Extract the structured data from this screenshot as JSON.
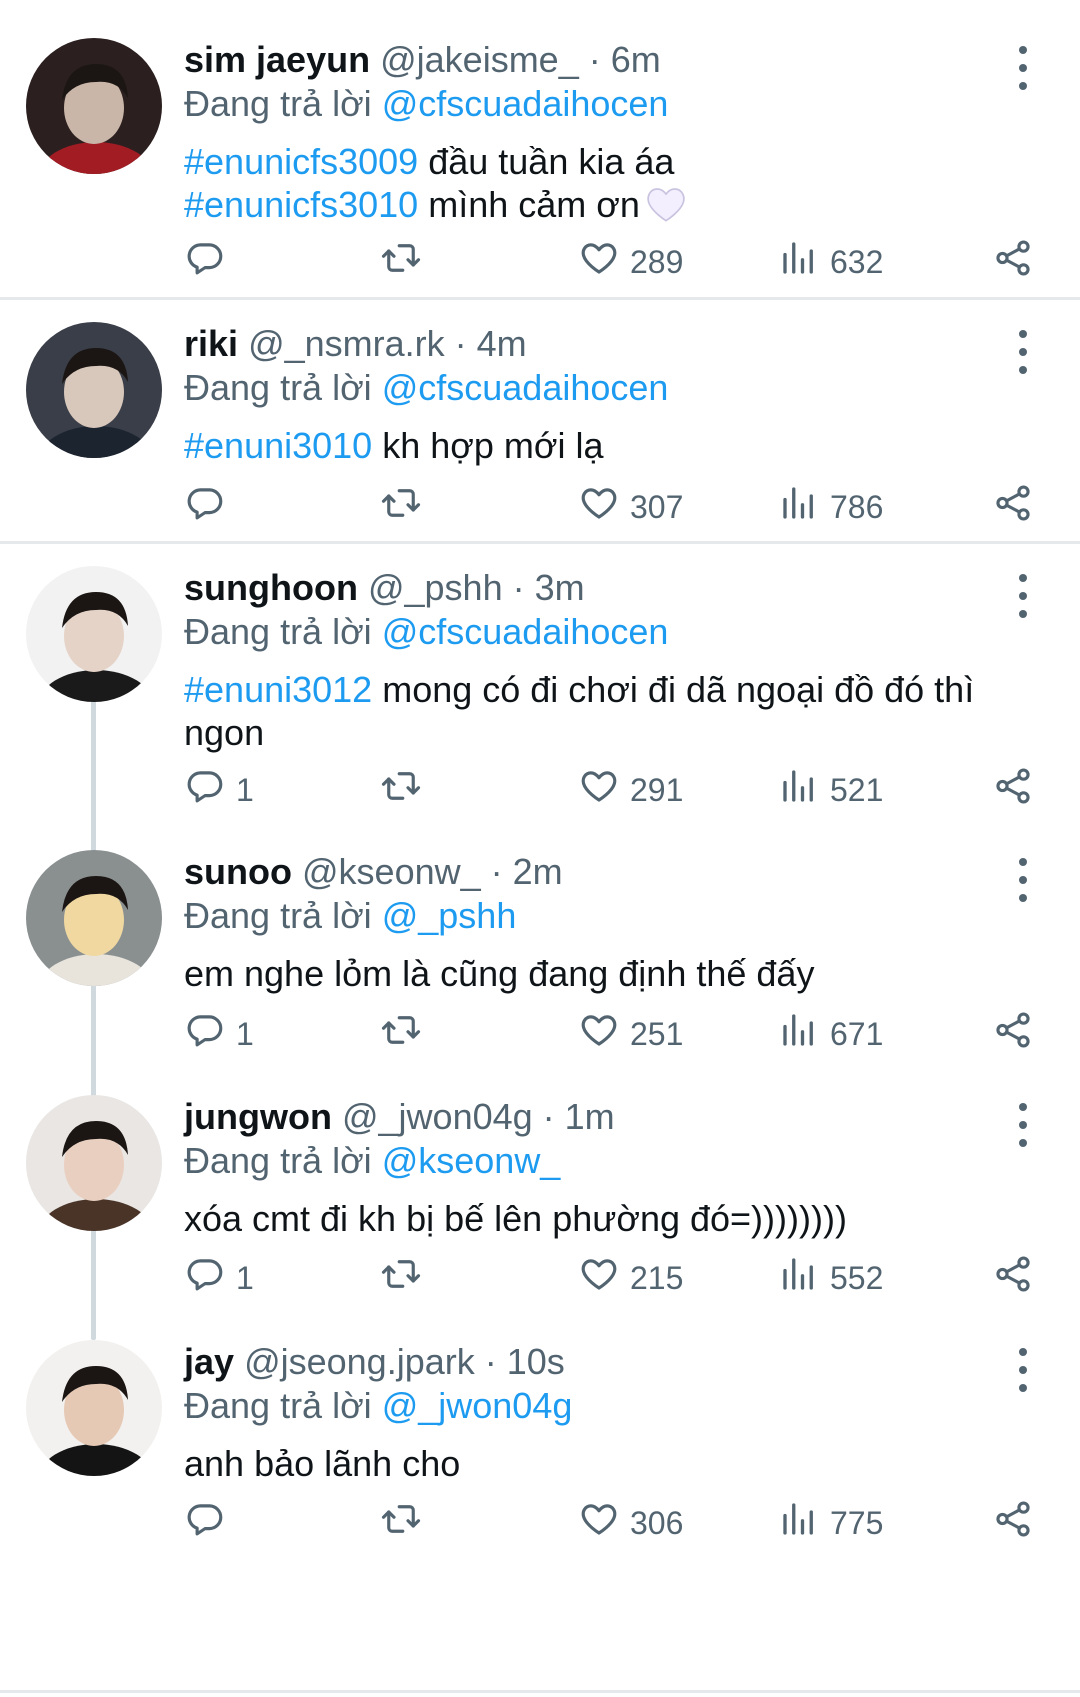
{
  "reply_prefix": "Đang trả lời",
  "tweets": [
    {
      "name": "sim jaeyun",
      "handle": "@jakeisme_",
      "time": "· 6m",
      "reply_to": "@cfscuadaihocen",
      "lines": [
        {
          "tag": "#enunicfs3009",
          "text": " đầu tuần kia áa"
        },
        {
          "tag": "#enunicfs3010",
          "text": " mình cảm ơn"
        }
      ],
      "emoji": "white-heart",
      "replies": "",
      "likes": "289",
      "views": "632",
      "avatar_colors": [
        "#2b1f1f",
        "#c9b6a8",
        "#a21c24"
      ]
    },
    {
      "name": "riki",
      "handle": "@_nsmra.rk",
      "time": "· 4m",
      "reply_to": "@cfscuadaihocen",
      "lines": [
        {
          "tag": "#enuni3010",
          "text": " kh hợp mới lạ"
        }
      ],
      "replies": "",
      "likes": "307",
      "views": "786",
      "avatar_colors": [
        "#3a3e48",
        "#d8c7bb",
        "#1c2430"
      ]
    },
    {
      "name": "sunghoon",
      "handle": "@_pshh",
      "time": "· 3m",
      "reply_to": "@cfscuadaihocen",
      "lines": [
        {
          "tag": "#enuni3012",
          "text": " mong có đi chơi đi dã ngoại đồ đó thì"
        },
        {
          "tag": "",
          "text": "ngon"
        }
      ],
      "replies": "1",
      "likes": "291",
      "views": "521",
      "avatar_colors": [
        "#f2f2f2",
        "#e6d3c8",
        "#1a1a1a"
      ]
    },
    {
      "name": "sunoo",
      "handle": "@kseonw_",
      "time": "· 2m",
      "reply_to": "@_pshh",
      "lines": [
        {
          "tag": "",
          "text": "em nghe lỏm là cũng đang định thế đấy"
        }
      ],
      "replies": "1",
      "likes": "251",
      "views": "671",
      "avatar_colors": [
        "#8a8f90",
        "#f0d8a0",
        "#e8e4dc"
      ]
    },
    {
      "name": "jungwon",
      "handle": "@_jwon04g",
      "time": "· 1m",
      "reply_to": "@kseonw_",
      "lines": [
        {
          "tag": "",
          "text": "xóa cmt đi kh bị bế lên phường đó=))))))))"
        }
      ],
      "replies": "1",
      "likes": "215",
      "views": "552",
      "avatar_colors": [
        "#e9e6e4",
        "#e9cfc0",
        "#4a3428"
      ]
    },
    {
      "name": "jay",
      "handle": "@jseong.jpark",
      "time": "· 10s",
      "reply_to": "@_jwon04g",
      "lines": [
        {
          "tag": "",
          "text": "anh bảo lãnh cho"
        }
      ],
      "replies": "",
      "likes": "306",
      "views": "775",
      "avatar_colors": [
        "#f3f1ef",
        "#e6c9b5",
        "#141414"
      ]
    }
  ]
}
